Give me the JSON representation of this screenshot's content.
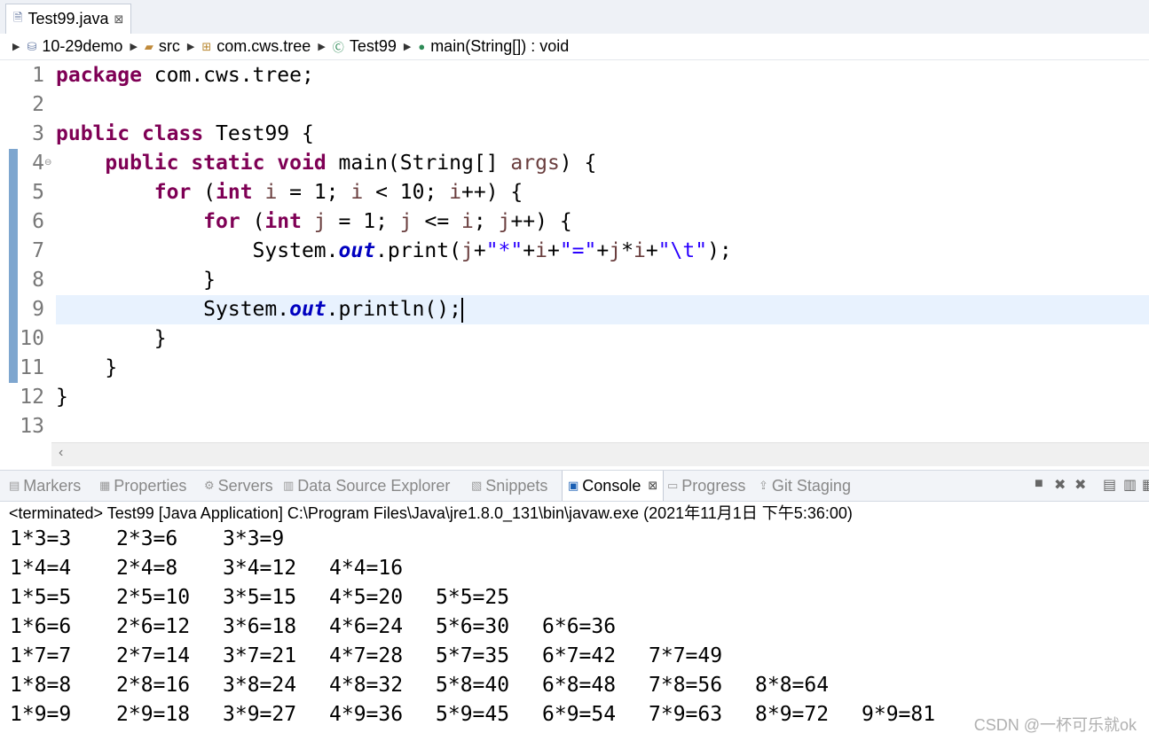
{
  "editor_tab": {
    "title": "Test99.java",
    "close": "⊠"
  },
  "breadcrumb": [
    "10-29demo",
    "src",
    "com.cws.tree",
    "Test99",
    "main(String[]) : void"
  ],
  "code": {
    "line_numbers": [
      "1",
      "2",
      "3",
      "4",
      "5",
      "6",
      "7",
      "8",
      "9",
      "10",
      "11",
      "12",
      "13"
    ],
    "current_line": "9",
    "lines": [
      [
        {
          "t": "package",
          "c": "kw"
        },
        {
          "t": " com.cws.tree;",
          "c": ""
        }
      ],
      [],
      [
        {
          "t": "public",
          "c": "kw"
        },
        {
          "t": " ",
          "c": ""
        },
        {
          "t": "class",
          "c": "kw"
        },
        {
          "t": " Test99 {",
          "c": ""
        }
      ],
      [
        {
          "t": "    ",
          "c": ""
        },
        {
          "t": "public",
          "c": "kw"
        },
        {
          "t": " ",
          "c": ""
        },
        {
          "t": "static",
          "c": "kw"
        },
        {
          "t": " ",
          "c": ""
        },
        {
          "t": "void",
          "c": "kw"
        },
        {
          "t": " main(String[] ",
          "c": ""
        },
        {
          "t": "args",
          "c": "var"
        },
        {
          "t": ") {",
          "c": ""
        }
      ],
      [
        {
          "t": "        ",
          "c": ""
        },
        {
          "t": "for",
          "c": "kw"
        },
        {
          "t": " (",
          "c": ""
        },
        {
          "t": "int",
          "c": "kw"
        },
        {
          "t": " ",
          "c": ""
        },
        {
          "t": "i",
          "c": "var"
        },
        {
          "t": " = 1; ",
          "c": ""
        },
        {
          "t": "i",
          "c": "var"
        },
        {
          "t": " < 10; ",
          "c": ""
        },
        {
          "t": "i",
          "c": "var"
        },
        {
          "t": "++) {",
          "c": ""
        }
      ],
      [
        {
          "t": "            ",
          "c": ""
        },
        {
          "t": "for",
          "c": "kw"
        },
        {
          "t": " (",
          "c": ""
        },
        {
          "t": "int",
          "c": "kw"
        },
        {
          "t": " ",
          "c": ""
        },
        {
          "t": "j",
          "c": "var"
        },
        {
          "t": " = 1; ",
          "c": ""
        },
        {
          "t": "j",
          "c": "var"
        },
        {
          "t": " <= ",
          "c": ""
        },
        {
          "t": "i",
          "c": "var"
        },
        {
          "t": "; ",
          "c": ""
        },
        {
          "t": "j",
          "c": "var"
        },
        {
          "t": "++) {",
          "c": ""
        }
      ],
      [
        {
          "t": "                System.",
          "c": ""
        },
        {
          "t": "out",
          "c": "fld"
        },
        {
          "t": ".print(",
          "c": ""
        },
        {
          "t": "j",
          "c": "var"
        },
        {
          "t": "+",
          "c": ""
        },
        {
          "t": "\"*\"",
          "c": "str"
        },
        {
          "t": "+",
          "c": ""
        },
        {
          "t": "i",
          "c": "var"
        },
        {
          "t": "+",
          "c": ""
        },
        {
          "t": "\"=\"",
          "c": "str"
        },
        {
          "t": "+",
          "c": ""
        },
        {
          "t": "j",
          "c": "var"
        },
        {
          "t": "*",
          "c": ""
        },
        {
          "t": "i",
          "c": "var"
        },
        {
          "t": "+",
          "c": ""
        },
        {
          "t": "\"\\t\"",
          "c": "str"
        },
        {
          "t": ");",
          "c": ""
        }
      ],
      [
        {
          "t": "            }",
          "c": ""
        }
      ],
      [
        {
          "t": "            System.",
          "c": ""
        },
        {
          "t": "out",
          "c": "fld"
        },
        {
          "t": ".println();",
          "c": ""
        }
      ],
      [
        {
          "t": "        }",
          "c": ""
        }
      ],
      [
        {
          "t": "    }",
          "c": ""
        }
      ],
      [
        {
          "t": "}",
          "c": ""
        }
      ],
      []
    ]
  },
  "view_tabs": [
    {
      "label": "Markers",
      "icon": "markers-icon",
      "glyph": "▤",
      "active": false
    },
    {
      "label": "Properties",
      "icon": "properties-icon",
      "glyph": "▦",
      "active": false
    },
    {
      "label": "Servers",
      "icon": "servers-icon",
      "glyph": "⚙",
      "active": false
    },
    {
      "label": "Data Source Explorer",
      "icon": "data-source-icon",
      "glyph": "▥",
      "active": false
    },
    {
      "label": "Snippets",
      "icon": "snippets-icon",
      "glyph": "▧",
      "active": false
    },
    {
      "label": "Console",
      "icon": "console-icon",
      "glyph": "▣",
      "active": true
    },
    {
      "label": "Progress",
      "icon": "progress-icon",
      "glyph": "▭",
      "active": false
    },
    {
      "label": "Git Staging",
      "icon": "git-staging-icon",
      "glyph": "⇪",
      "active": false
    }
  ],
  "console": {
    "status": "<terminated> Test99 [Java Application] C:\\Program Files\\Java\\jre1.8.0_131\\bin\\javaw.exe (2021年11月1日 下午5:36:00)",
    "output": [
      [
        "1*3=3",
        "2*3=6",
        "3*3=9"
      ],
      [
        "1*4=4",
        "2*4=8",
        "3*4=12",
        "4*4=16"
      ],
      [
        "1*5=5",
        "2*5=10",
        "3*5=15",
        "4*5=20",
        "5*5=25"
      ],
      [
        "1*6=6",
        "2*6=12",
        "3*6=18",
        "4*6=24",
        "5*6=30",
        "6*6=36"
      ],
      [
        "1*7=7",
        "2*7=14",
        "3*7=21",
        "4*7=28",
        "5*7=35",
        "6*7=42",
        "7*7=49"
      ],
      [
        "1*8=8",
        "2*8=16",
        "3*8=24",
        "4*8=32",
        "5*8=40",
        "6*8=48",
        "7*8=56",
        "8*8=64"
      ],
      [
        "1*9=9",
        "2*9=18",
        "3*9=27",
        "4*9=36",
        "5*9=45",
        "6*9=54",
        "7*9=63",
        "8*9=72",
        "9*9=81"
      ]
    ]
  },
  "watermark": "CSDN @一杯可乐就ok"
}
